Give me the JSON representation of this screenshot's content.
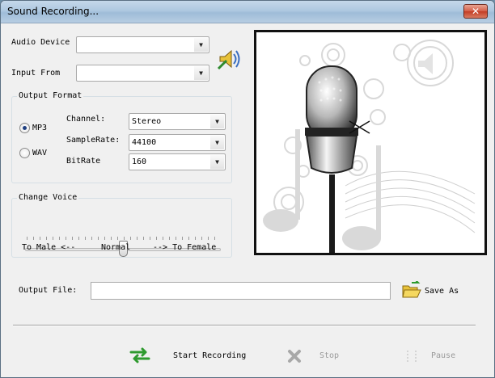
{
  "window": {
    "title": "Sound Recording...",
    "close_glyph": "✕"
  },
  "audio_device": {
    "label": "Audio Device",
    "value": ""
  },
  "input_from": {
    "label": "Input From",
    "value": ""
  },
  "speaker_icon": "speaker-volume-icon",
  "output_format": {
    "caption": "Output Format",
    "mp3_label": "MP3",
    "wav_label": "WAV",
    "selected": "MP3",
    "channel": {
      "label": "Channel:",
      "value": "Stereo"
    },
    "samplerate": {
      "label": "SampleRate:",
      "value": "44100"
    },
    "bitrate": {
      "label": "BitRate",
      "value": "160"
    }
  },
  "change_voice": {
    "caption": "Change Voice",
    "left_label": "To Male <--",
    "center_label": "Normal",
    "right_label": "--> To Female",
    "slider_value": 0.5
  },
  "output_file": {
    "label": "Output File:",
    "value": ""
  },
  "save_as": {
    "label": "Save As",
    "icon": "folder-open-icon"
  },
  "actions": {
    "start": {
      "label": "Start Recording",
      "icon": "swap-arrows-icon"
    },
    "stop": {
      "label": "Stop",
      "icon": "stop-x-icon"
    },
    "pause": {
      "label": "Pause",
      "icon": "pause-icon"
    }
  },
  "colors": {
    "title_bar": "#aec8e0",
    "close_button": "#c33d25",
    "radio_selected": "#1f3f80",
    "disabled_text": "#9a9a9a",
    "start_icon": "#2e9a2e"
  }
}
